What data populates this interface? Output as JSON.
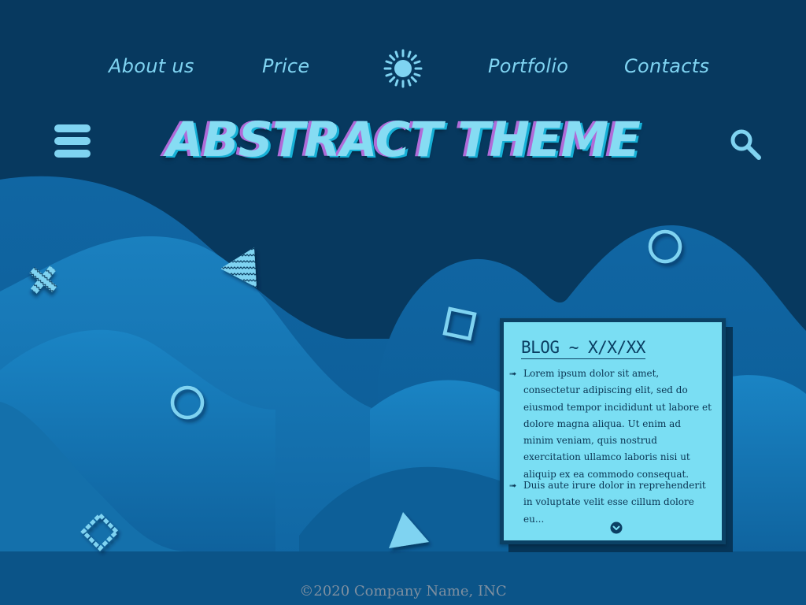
{
  "nav": {
    "items": [
      {
        "label": "About us"
      },
      {
        "label": "Price"
      },
      {
        "label": "Portfolio"
      },
      {
        "label": "Contacts"
      }
    ],
    "logo_icon": "sun-icon"
  },
  "header": {
    "title": "ABSTRACT THEME",
    "menu_icon": "hamburger-icon",
    "search_icon": "search-icon"
  },
  "blog": {
    "title": "BLOG ~ X/X/XX",
    "paragraphs": [
      "Lorem ipsum dolor sit amet, consectetur adipiscing elit, sed do eiusmod tempor incididunt ut labore et dolore magna aliqua. Ut enim ad minim veniam, quis nostrud exercitation ullamco laboris nisi ut aliquip ex ea commodo consequat.",
      "Duis aute irure dolor in reprehenderit in voluptate velit esse cillum dolore eu..."
    ],
    "bullet": "➟",
    "more_icon": "chevron-down-icon"
  },
  "footer": {
    "copyright": "©2020 Company Name, INC"
  },
  "colors": {
    "background": "#07395f",
    "accent": "#7fd3f1",
    "hills": "#1579b4",
    "card": "#7adef3",
    "title_glitch_purple": "#b06bd8"
  },
  "decorations": [
    "cross-shape-icon",
    "triangle-zigzag-icon",
    "circle-outline-icon",
    "square-outline-icon",
    "diamond-dashed-icon",
    "triangle-solid-icon"
  ]
}
